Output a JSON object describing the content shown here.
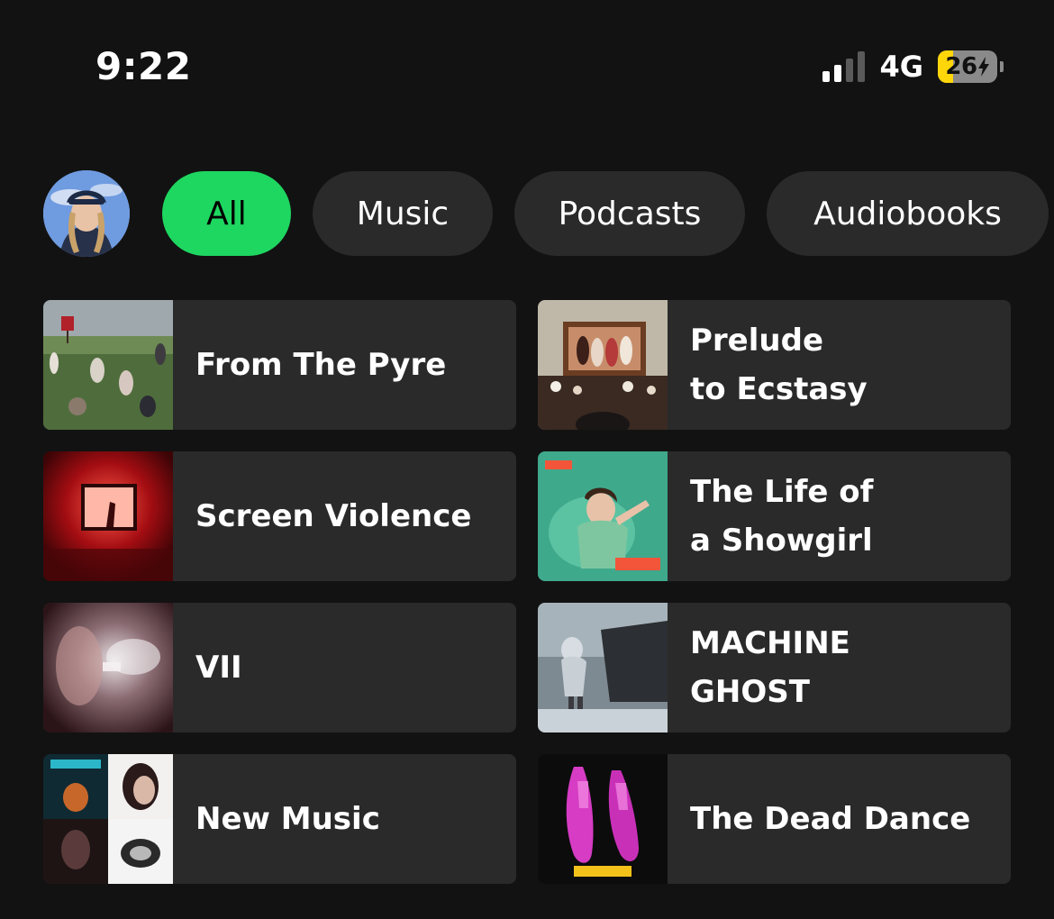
{
  "status_bar": {
    "time": "9:22",
    "network": "4G",
    "battery_level": "26",
    "battery_fraction": 0.26,
    "battery_color": "#ffd60a",
    "charging_icon": "bolt-icon",
    "signal_bars_active": 2,
    "signal_bars_total": 4
  },
  "profile": {
    "avatar_icon": "user-avatar"
  },
  "filters": {
    "items": [
      {
        "label": "All",
        "active": true
      },
      {
        "label": "Music",
        "active": false
      },
      {
        "label": "Podcasts",
        "active": false
      },
      {
        "label": "Audiobooks",
        "active": false
      }
    ],
    "active_color": "#1ed760"
  },
  "shortcuts": [
    {
      "title_lines": [
        "From The Pyre"
      ]
    },
    {
      "title_lines": [
        "Prelude",
        "to Ecstasy"
      ]
    },
    {
      "title_lines": [
        "Screen Violence"
      ]
    },
    {
      "title_lines": [
        "The Life of",
        "a Showgirl"
      ]
    },
    {
      "title_lines": [
        "VII"
      ]
    },
    {
      "title_lines": [
        "MACHINE",
        "GHOST"
      ]
    },
    {
      "title_lines": [
        "New Music"
      ]
    },
    {
      "title_lines": [
        "The Dead Dance"
      ]
    }
  ]
}
